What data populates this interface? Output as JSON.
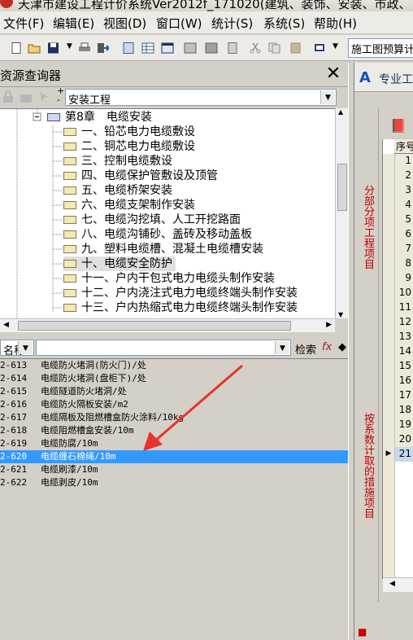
{
  "window": {
    "title": "天津市建设工程计价系统Ver2012f_171020(建筑、装饰、安装、市政、"
  },
  "menu": {
    "items": [
      "文件(F)",
      "编辑(E)",
      "视图(D)",
      "窗口(W)",
      "统计(S)",
      "系统(S)",
      "帮助(H)"
    ]
  },
  "toolbar": {
    "project_type": "施工图预算计价"
  },
  "left_panel": {
    "title": "资源查询器",
    "category_combo": "安装工程",
    "tree": {
      "chapter": "第8章　电缆安装",
      "items": [
        "一、铅芯电力电缆敷设",
        "二、铜芯电力电缆敷设",
        "三、控制电缆敷设",
        "四、电缆保护管敷设及顶管",
        "五、电缆桥架安装",
        "六、电缆支架制作安装",
        "七、电缆沟挖填、人工开挖路面",
        "八、电缆沟铺砂、盖砖及移动盖板",
        "九、塑料电缆槽、混凝土电缆槽安装",
        "十、电缆安全防护",
        "十一、户内干包式电力电缆头制作安装",
        "十二、户内浇注式电力电缆终端头制作安装",
        "十三、户内热缩式电力电缆终端头制作安装"
      ],
      "selected_index": 9
    },
    "search": {
      "field_label": "名称",
      "query": "",
      "search_label": "检索"
    },
    "list": [
      {
        "code": "2-613",
        "name": "电缆防火堵洞(防火门)/处"
      },
      {
        "code": "2-614",
        "name": "电缆防火堵洞(盘柜下)/处"
      },
      {
        "code": "2-615",
        "name": "电缆隧道防火堵洞/处"
      },
      {
        "code": "2-616",
        "name": "电缆防火隔板安装/m2"
      },
      {
        "code": "2-617",
        "name": "电缆隔板及阻燃槽盒防火涂料/10kg"
      },
      {
        "code": "2-618",
        "name": "电缆阻燃槽盒安装/10m"
      },
      {
        "code": "2-619",
        "name": "电缆防腐/10m"
      },
      {
        "code": "2-620",
        "name": "电缆缠石棉绳/10m"
      },
      {
        "code": "2-621",
        "name": "电缆刷漆/10m"
      },
      {
        "code": "2-622",
        "name": "电缆剥皮/10m"
      }
    ],
    "selected_list_index": 7
  },
  "right_panel": {
    "tab_title": "专业工",
    "vertical_tab_1": "分部分项工程项目",
    "vertical_tab_2": "按系数计取的措施项目",
    "grid_header": "序号",
    "row_numbers": [
      "1",
      "2",
      "3",
      "4",
      "5",
      "6",
      "7",
      "8",
      "9",
      "10",
      "11",
      "12",
      "13",
      "14",
      "15",
      "16",
      "17",
      "18",
      "19",
      "20",
      "21"
    ],
    "current_row": "21"
  },
  "colors": {
    "selection": "#3399ff",
    "arrow": "#e8332a"
  }
}
